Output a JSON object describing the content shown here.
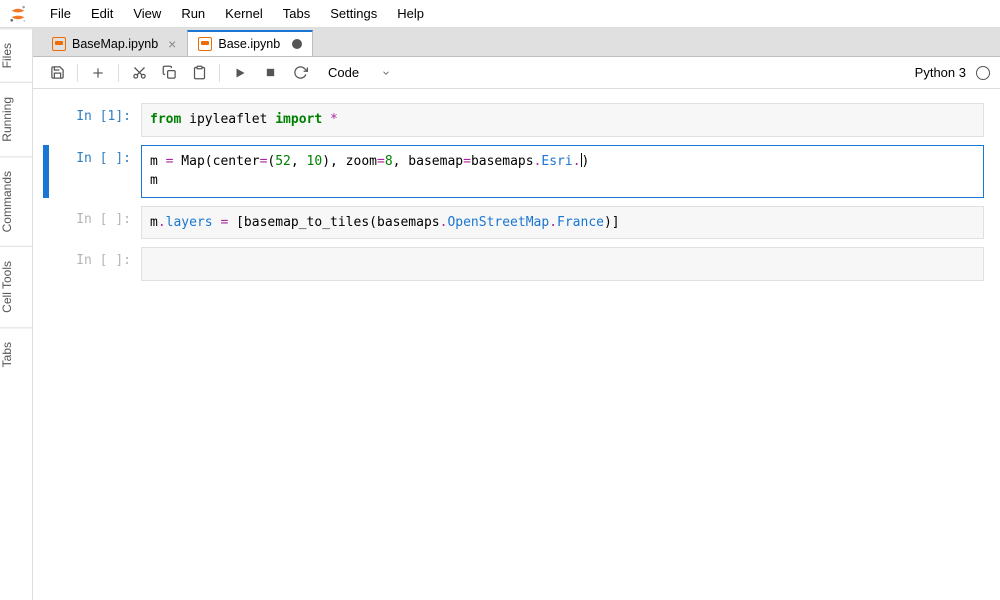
{
  "menu": {
    "items": [
      "File",
      "Edit",
      "View",
      "Run",
      "Kernel",
      "Tabs",
      "Settings",
      "Help"
    ]
  },
  "sidebar": {
    "tabs": [
      "Files",
      "Running",
      "Commands",
      "Cell Tools",
      "Tabs"
    ]
  },
  "tabs": [
    {
      "label": "BaseMap.ipynb",
      "active": false,
      "dirty": false
    },
    {
      "label": "Base.ipynb",
      "active": true,
      "dirty": true
    }
  ],
  "toolbar": {
    "celltype": "Code"
  },
  "kernel": {
    "name": "Python 3"
  },
  "cells": [
    {
      "prompt": "In [1]:",
      "prompt_dim": false,
      "selected": false,
      "tokens": [
        {
          "cls": "tok-kw",
          "t": "from"
        },
        {
          "cls": "tok-plain",
          "t": " ipyleaflet "
        },
        {
          "cls": "tok-kw",
          "t": "import"
        },
        {
          "cls": "tok-plain",
          "t": " "
        },
        {
          "cls": "tok-op",
          "t": "*"
        }
      ]
    },
    {
      "prompt": "In [ ]:",
      "prompt_dim": false,
      "selected": true,
      "tokens": [
        {
          "cls": "tok-plain",
          "t": "m "
        },
        {
          "cls": "tok-op",
          "t": "="
        },
        {
          "cls": "tok-plain",
          "t": " Map(center"
        },
        {
          "cls": "tok-op",
          "t": "="
        },
        {
          "cls": "tok-plain",
          "t": "("
        },
        {
          "cls": "tok-num",
          "t": "52"
        },
        {
          "cls": "tok-plain",
          "t": ", "
        },
        {
          "cls": "tok-num",
          "t": "10"
        },
        {
          "cls": "tok-plain",
          "t": "), zoom"
        },
        {
          "cls": "tok-op",
          "t": "="
        },
        {
          "cls": "tok-num",
          "t": "8"
        },
        {
          "cls": "tok-plain",
          "t": ", basemap"
        },
        {
          "cls": "tok-op",
          "t": "="
        },
        {
          "cls": "tok-plain",
          "t": "basemaps"
        },
        {
          "cls": "tok-op",
          "t": "."
        },
        {
          "cls": "tok-attr",
          "t": "Esri"
        },
        {
          "cls": "tok-op",
          "t": "."
        },
        {
          "cls": "cursor",
          "t": ""
        },
        {
          "cls": "tok-plain",
          "t": ")\nm"
        }
      ]
    },
    {
      "prompt": "In [ ]:",
      "prompt_dim": true,
      "selected": false,
      "tokens": [
        {
          "cls": "tok-plain",
          "t": "m"
        },
        {
          "cls": "tok-op",
          "t": "."
        },
        {
          "cls": "tok-attr",
          "t": "layers"
        },
        {
          "cls": "tok-plain",
          "t": " "
        },
        {
          "cls": "tok-op",
          "t": "="
        },
        {
          "cls": "tok-plain",
          "t": " [basemap_to_tiles(basemaps"
        },
        {
          "cls": "tok-op",
          "t": "."
        },
        {
          "cls": "tok-attr",
          "t": "OpenStreetMap"
        },
        {
          "cls": "tok-op",
          "t": "."
        },
        {
          "cls": "tok-attr",
          "t": "France"
        },
        {
          "cls": "tok-plain",
          "t": ")]"
        }
      ]
    },
    {
      "prompt": "In [ ]:",
      "prompt_dim": true,
      "selected": false,
      "tokens": []
    }
  ]
}
